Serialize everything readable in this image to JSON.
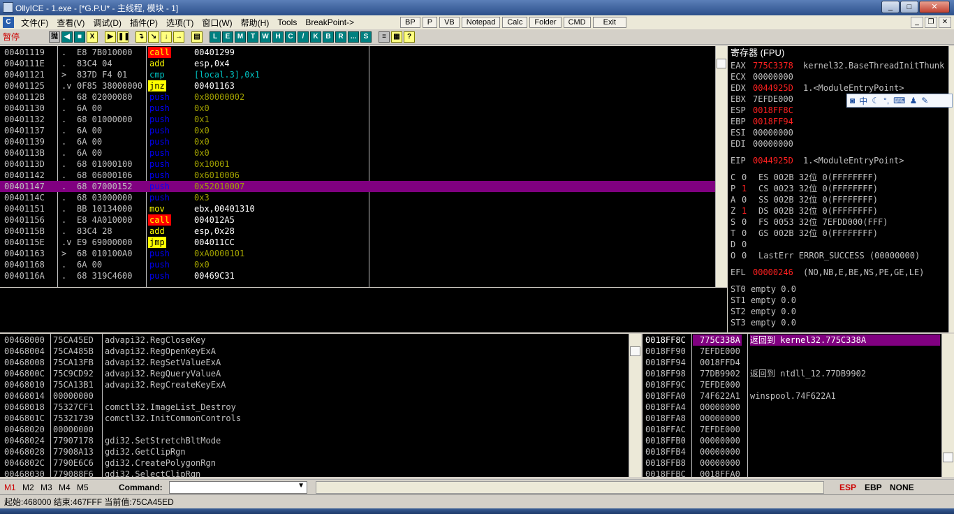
{
  "window": {
    "title": "OllyICE - 1.exe - [*G.P.U* - 主线程, 模块 - 1]",
    "buttons": {
      "minimize": "_",
      "maximize": "□",
      "close": "✕"
    }
  },
  "menu": {
    "items": [
      "文件(F)",
      "查看(V)",
      "调试(D)",
      "插件(P)",
      "选项(T)",
      "窗口(W)",
      "帮助(H)",
      "Tools",
      "BreakPoint->"
    ],
    "tool_buttons": [
      "BP",
      "P",
      "VB",
      "Notepad",
      "Calc",
      "Folder",
      "CMD",
      "Exit"
    ],
    "mdi_buttons": [
      "_",
      "❐",
      "✕"
    ]
  },
  "toolbar": {
    "status": "暂停",
    "buttons1": [
      "抛",
      "◀",
      "■",
      "X",
      "▶",
      "❚❚",
      "↴",
      "↘",
      "↓",
      "→",
      "▤"
    ],
    "letter_buttons": [
      "L",
      "E",
      "M",
      "T",
      "W",
      "H",
      "C",
      "/",
      "K",
      "B",
      "R",
      "...",
      "S"
    ],
    "tail_buttons": [
      "≡",
      "▦",
      "?"
    ]
  },
  "disasm": {
    "rows": [
      {
        "addr": "00401119",
        "mark": ".",
        "hex": "E8 7B010000",
        "mnem": "call",
        "cls": "call",
        "ops": "00401299"
      },
      {
        "addr": "0040111E",
        "mark": ".",
        "hex": "83C4 04",
        "mnem": "add",
        "cls": "add",
        "ops": "esp,0x4"
      },
      {
        "addr": "00401121",
        "mark": ">",
        "hex": "837D F4 01",
        "mnem": "cmp",
        "cls": "cmp",
        "ops": "[local.3],0x1"
      },
      {
        "addr": "00401125",
        "mark": ".v",
        "hex": "0F85 38000000",
        "mnem": "jnz",
        "cls": "jmp",
        "ops": "00401163"
      },
      {
        "addr": "0040112B",
        "mark": ".",
        "hex": "68 02000080",
        "mnem": "push",
        "cls": "push",
        "ops": "0x80000002"
      },
      {
        "addr": "00401130",
        "mark": ".",
        "hex": "6A 00",
        "mnem": "push",
        "cls": "push",
        "ops": "0x0"
      },
      {
        "addr": "00401132",
        "mark": ".",
        "hex": "68 01000000",
        "mnem": "push",
        "cls": "push",
        "ops": "0x1"
      },
      {
        "addr": "00401137",
        "mark": ".",
        "hex": "6A 00",
        "mnem": "push",
        "cls": "push",
        "ops": "0x0"
      },
      {
        "addr": "00401139",
        "mark": ".",
        "hex": "6A 00",
        "mnem": "push",
        "cls": "push",
        "ops": "0x0"
      },
      {
        "addr": "0040113B",
        "mark": ".",
        "hex": "6A 00",
        "mnem": "push",
        "cls": "push",
        "ops": "0x0"
      },
      {
        "addr": "0040113D",
        "mark": ".",
        "hex": "68 01000100",
        "mnem": "push",
        "cls": "push",
        "ops": "0x10001"
      },
      {
        "addr": "00401142",
        "mark": ".",
        "hex": "68 06000106",
        "mnem": "push",
        "cls": "push",
        "ops": "0x6010006"
      },
      {
        "addr": "00401147",
        "mark": ".",
        "hex": "68 07000152",
        "mnem": "push",
        "cls": "push",
        "ops": "0x52010007",
        "selected": true
      },
      {
        "addr": "0040114C",
        "mark": ".",
        "hex": "68 03000000",
        "mnem": "push",
        "cls": "push",
        "ops": "0x3"
      },
      {
        "addr": "00401151",
        "mark": ".",
        "hex": "BB 10134000",
        "mnem": "mov",
        "cls": "mov",
        "ops": "ebx,00401310"
      },
      {
        "addr": "00401156",
        "mark": ".",
        "hex": "E8 4A010000",
        "mnem": "call",
        "cls": "call",
        "ops": "004012A5"
      },
      {
        "addr": "0040115B",
        "mark": ".",
        "hex": "83C4 28",
        "mnem": "add",
        "cls": "add",
        "ops": "esp,0x28"
      },
      {
        "addr": "0040115E",
        "mark": ".v",
        "hex": "E9 69000000",
        "mnem": "jmp",
        "cls": "jmp",
        "ops": "004011CC"
      },
      {
        "addr": "00401163",
        "mark": ">",
        "hex": "68 010100A0",
        "mnem": "push",
        "cls": "push",
        "ops": "0xA0000101"
      },
      {
        "addr": "00401168",
        "mark": ".",
        "hex": "6A 00",
        "mnem": "push",
        "cls": "push",
        "ops": "0x0"
      },
      {
        "addr": "0040116A",
        "mark": ".",
        "hex": "68 319C4600",
        "mnem": "push",
        "cls": "push",
        "ops": "00469C31"
      }
    ]
  },
  "registers": {
    "header": "寄存器 (FPU)",
    "gp": [
      {
        "name": "EAX",
        "value": "775C3378",
        "changed": true,
        "comment": "kernel32.BaseThreadInitThunk"
      },
      {
        "name": "ECX",
        "value": "00000000",
        "changed": false,
        "comment": ""
      },
      {
        "name": "EDX",
        "value": "0044925D",
        "changed": true,
        "comment": "1.<ModuleEntryPoint>"
      },
      {
        "name": "EBX",
        "value": "7EFDE000",
        "changed": false,
        "comment": ""
      },
      {
        "name": "ESP",
        "value": "0018FF8C",
        "changed": true,
        "comment": ""
      },
      {
        "name": "EBP",
        "value": "0018FF94",
        "changed": true,
        "comment": ""
      },
      {
        "name": "ESI",
        "value": "00000000",
        "changed": false,
        "comment": ""
      },
      {
        "name": "EDI",
        "value": "00000000",
        "changed": false,
        "comment": ""
      }
    ],
    "eip": {
      "name": "EIP",
      "value": "0044925D",
      "comment": "1.<ModuleEntryPoint>"
    },
    "flags": [
      {
        "f": "C",
        "v": "0",
        "red": false,
        "seg": "ES 002B 32位 0(FFFFFFFF)"
      },
      {
        "f": "P",
        "v": "1",
        "red": true,
        "seg": "CS 0023 32位 0(FFFFFFFF)"
      },
      {
        "f": "A",
        "v": "0",
        "red": false,
        "seg": "SS 002B 32位 0(FFFFFFFF)"
      },
      {
        "f": "Z",
        "v": "1",
        "red": true,
        "seg": "DS 002B 32位 0(FFFFFFFF)"
      },
      {
        "f": "S",
        "v": "0",
        "red": false,
        "seg": "FS 0053 32位 7EFDD000(FFF)"
      },
      {
        "f": "T",
        "v": "0",
        "red": false,
        "seg": "GS 002B 32位 0(FFFFFFFF)"
      },
      {
        "f": "D",
        "v": "0",
        "red": false,
        "seg": ""
      },
      {
        "f": "O",
        "v": "0",
        "red": false,
        "seg": "LastErr ERROR_SUCCESS (00000000)"
      }
    ],
    "efl": {
      "name": "EFL",
      "value": "00000246",
      "comment": "(NO,NB,E,BE,NS,PE,GE,LE)"
    },
    "fpu": [
      "ST0 empty 0.0",
      "ST1 empty 0.0",
      "ST2 empty 0.0",
      "ST3 empty 0.0"
    ]
  },
  "ime": {
    "label": "中"
  },
  "dump": {
    "rows": [
      {
        "addr": "00468000",
        "val": "75CA45ED",
        "sym": "advapi32.RegCloseKey"
      },
      {
        "addr": "00468004",
        "val": "75CA485B",
        "sym": "advapi32.RegOpenKeyExA"
      },
      {
        "addr": "00468008",
        "val": "75CA13FB",
        "sym": "advapi32.RegSetValueExA"
      },
      {
        "addr": "0046800C",
        "val": "75C9CD92",
        "sym": "advapi32.RegQueryValueA"
      },
      {
        "addr": "00468010",
        "val": "75CA13B1",
        "sym": "advapi32.RegCreateKeyExA"
      },
      {
        "addr": "00468014",
        "val": "00000000",
        "sym": ""
      },
      {
        "addr": "00468018",
        "val": "75327CF1",
        "sym": "comctl32.ImageList_Destroy"
      },
      {
        "addr": "0046801C",
        "val": "75321739",
        "sym": "comctl32.InitCommonControls"
      },
      {
        "addr": "00468020",
        "val": "00000000",
        "sym": ""
      },
      {
        "addr": "00468024",
        "val": "77907178",
        "sym": "gdi32.SetStretchBltMode"
      },
      {
        "addr": "00468028",
        "val": "77908A13",
        "sym": "gdi32.GetClipRgn"
      },
      {
        "addr": "0046802C",
        "val": "7790E6C6",
        "sym": "gdi32.CreatePolygonRgn"
      },
      {
        "addr": "00468030",
        "val": "779088F6",
        "sym": "gdi32.SelectClipRgn"
      }
    ]
  },
  "stack": {
    "rows": [
      {
        "addr": "0018FF8C",
        "val": "775C338A",
        "cmt": "返回到 kernel32.775C338A",
        "selected": true
      },
      {
        "addr": "0018FF90",
        "val": "7EFDE000",
        "cmt": ""
      },
      {
        "addr": "0018FF94",
        "val": "0018FFD4",
        "cmt": ""
      },
      {
        "addr": "0018FF98",
        "val": "77DB9902",
        "cmt": "返回到 ntdll_12.77DB9902"
      },
      {
        "addr": "0018FF9C",
        "val": "7EFDE000",
        "cmt": ""
      },
      {
        "addr": "0018FFA0",
        "val": "74F622A1",
        "cmt": "winspool.74F622A1"
      },
      {
        "addr": "0018FFA4",
        "val": "00000000",
        "cmt": ""
      },
      {
        "addr": "0018FFA8",
        "val": "00000000",
        "cmt": ""
      },
      {
        "addr": "0018FFAC",
        "val": "7EFDE000",
        "cmt": ""
      },
      {
        "addr": "0018FFB0",
        "val": "00000000",
        "cmt": ""
      },
      {
        "addr": "0018FFB4",
        "val": "00000000",
        "cmt": ""
      },
      {
        "addr": "0018FFB8",
        "val": "00000000",
        "cmt": ""
      },
      {
        "addr": "0018FFBC",
        "val": "0018FFA0",
        "cmt": ""
      }
    ]
  },
  "bottom": {
    "marks": [
      "M1",
      "M2",
      "M3",
      "M4",
      "M5"
    ],
    "command_label": "Command:",
    "command_value": "",
    "regs": [
      "ESP",
      "EBP",
      "NONE"
    ]
  },
  "status": {
    "text": "起始:468000 结束:467FFF 当前值:75CA45ED"
  },
  "colors": {
    "selection": "#800080",
    "changed": "#ff2020",
    "call_bg": "#ff0000",
    "jmp_bg": "#ffff00",
    "push": "#0000ff"
  }
}
